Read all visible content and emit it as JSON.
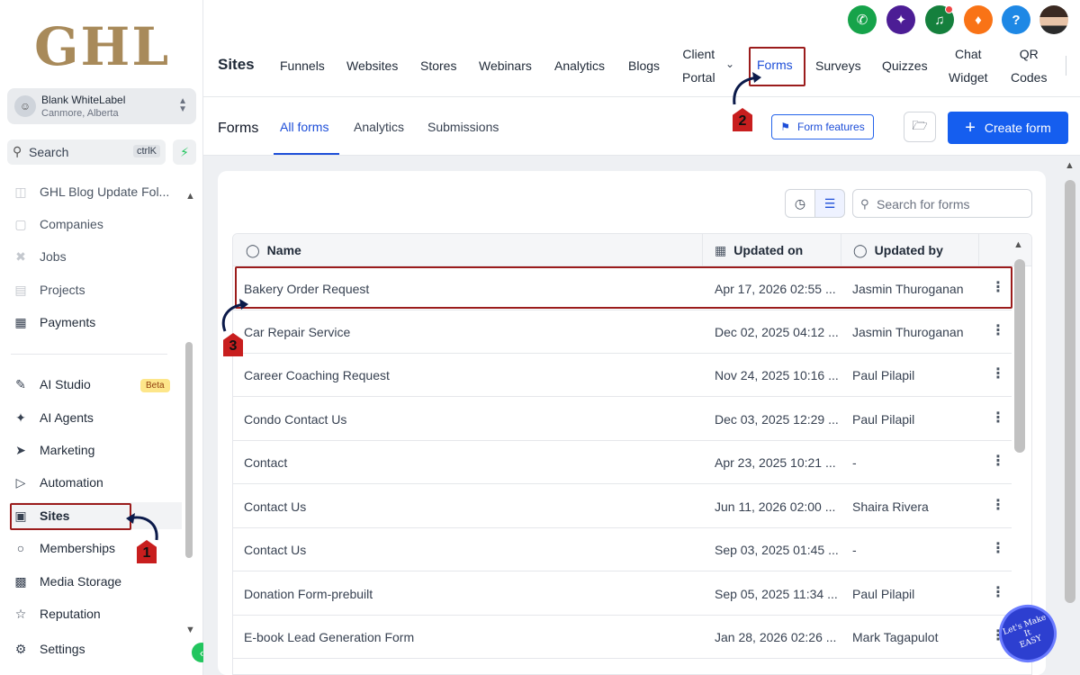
{
  "sidebar": {
    "logo": "GHL",
    "account": {
      "name": "Blank WhiteLabel",
      "location": "Canmore, Alberta"
    },
    "search": {
      "label": "Search",
      "shortcut": "ctrlK"
    },
    "items": [
      {
        "label": "GHL Blog Update Fol...",
        "icon": "folder-icon"
      },
      {
        "label": "Companies",
        "icon": "building-icon"
      },
      {
        "label": "Jobs",
        "icon": "jobs-icon"
      },
      {
        "label": "Projects",
        "icon": "projects-icon"
      },
      {
        "label": "Payments",
        "icon": "payments-icon"
      },
      {
        "label": "AI Studio",
        "icon": "ai-studio-icon",
        "badge": "Beta"
      },
      {
        "label": "AI Agents",
        "icon": "sparkle-icon"
      },
      {
        "label": "Marketing",
        "icon": "send-icon"
      },
      {
        "label": "Automation",
        "icon": "automation-icon"
      },
      {
        "label": "Sites",
        "icon": "sites-icon"
      },
      {
        "label": "Memberships",
        "icon": "medal-icon"
      },
      {
        "label": "Media Storage",
        "icon": "image-icon"
      },
      {
        "label": "Reputation",
        "icon": "star-icon"
      },
      {
        "label": "Settings",
        "icon": "gear-icon"
      }
    ]
  },
  "topnav": {
    "title": "Sites",
    "tabs": [
      "Funnels",
      "Websites",
      "Stores",
      "Webinars",
      "Analytics",
      "Blogs"
    ],
    "client_portal": [
      "Client",
      "Portal"
    ],
    "active_tab": "Forms",
    "tabs_after": [
      "Surveys",
      "Quizzes"
    ],
    "chat_widget": [
      "Chat",
      "Widget"
    ],
    "qr_codes": [
      "QR",
      "Codes"
    ]
  },
  "subnav": {
    "title": "Forms",
    "tabs": [
      "All forms",
      "Analytics",
      "Submissions"
    ],
    "form_features": "Form features",
    "create_form": "Create form"
  },
  "forms_search": {
    "placeholder": "Search for forms"
  },
  "table": {
    "headers": {
      "name": "Name",
      "updated_on": "Updated on",
      "updated_by": "Updated by"
    },
    "rows": [
      {
        "name": "Bakery Order Request",
        "updated_on": "Apr 17, 2026 02:55 ...",
        "updated_by": "Jasmin Thuroganan"
      },
      {
        "name": "Car Repair Service",
        "updated_on": "Dec 02, 2025 04:12 ...",
        "updated_by": "Jasmin Thuroganan"
      },
      {
        "name": "Career Coaching Request",
        "updated_on": "Nov 24, 2025 10:16 ...",
        "updated_by": "Paul Pilapil"
      },
      {
        "name": "Condo Contact Us",
        "updated_on": "Dec 03, 2025 12:29 ...",
        "updated_by": "Paul Pilapil"
      },
      {
        "name": "Contact",
        "updated_on": "Apr 23, 2025 10:21 ...",
        "updated_by": "-"
      },
      {
        "name": "Contact Us",
        "updated_on": "Jun 11, 2026 02:00 ...",
        "updated_by": "Shaira Rivera"
      },
      {
        "name": "Contact Us",
        "updated_on": "Sep 03, 2025 01:45 ...",
        "updated_by": "-"
      },
      {
        "name": "Donation Form-prebuilt",
        "updated_on": "Sep 05, 2025 11:34 ...",
        "updated_by": "Paul Pilapil"
      },
      {
        "name": "E-book Lead Generation Form",
        "updated_on": "Jan 28, 2026 02:26 ...",
        "updated_by": "Mark Tagapulot"
      }
    ]
  },
  "annotations": {
    "step1": "1",
    "step2": "2",
    "step3": "3"
  },
  "promo": {
    "line1": "Let's Make",
    "line2": "It",
    "line3": "EASY"
  },
  "colors": {
    "accent": "#155eef",
    "highlight": "#9b1c1c",
    "phone": "#16a34a",
    "ai": "#4c1d95",
    "megaphone": "#15803d",
    "bell": "#f97316",
    "help": "#1e88e5"
  }
}
